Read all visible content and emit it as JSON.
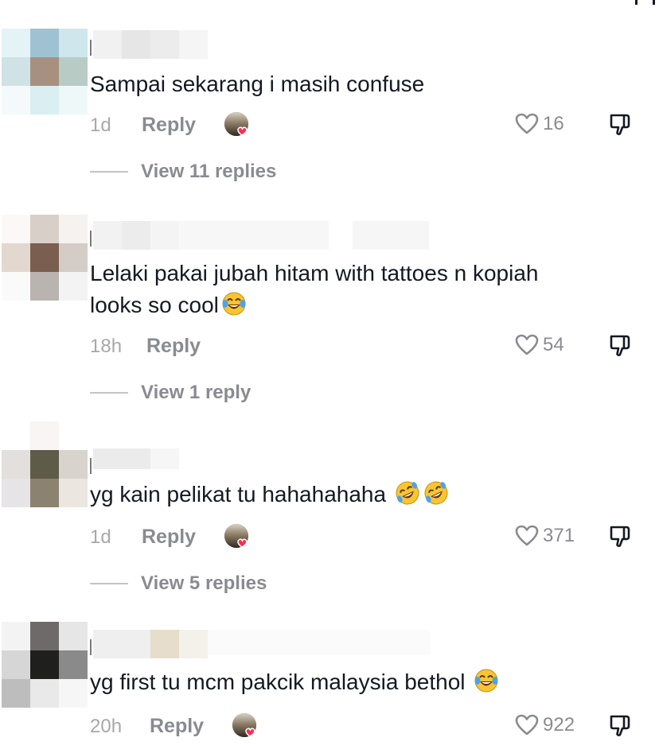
{
  "comments": [
    {
      "text": "Sampai sekarang i masih confuse",
      "time": "1d",
      "reply_label": "Reply",
      "likes": "16",
      "view_replies": "View 11 replies",
      "emoji": "",
      "creator_liked": true
    },
    {
      "text_line1": "Lelaki pakai jubah hitam with tattoes n kopiah",
      "text_line2": "looks so cool",
      "time": "18h",
      "reply_label": "Reply",
      "likes": "54",
      "view_replies": "View 1 reply",
      "emoji": "tears-of-joy",
      "creator_liked": false
    },
    {
      "text": "yg kain pelikat tu hahahahaha ",
      "time": "1d",
      "reply_label": "Reply",
      "likes": "371",
      "view_replies": "View 5 replies",
      "emoji": "rolling-on-floor-laughing",
      "creator_liked": true
    },
    {
      "text": "yg first tu mcm pakcik malaysia bethol ",
      "time": "20h",
      "reply_label": "Reply",
      "likes": "922",
      "emoji": "tears-of-joy",
      "creator_liked": true
    }
  ],
  "colors": {
    "text": "#161823",
    "secondary": "#8a8b91",
    "heart": "#fe2c55"
  }
}
